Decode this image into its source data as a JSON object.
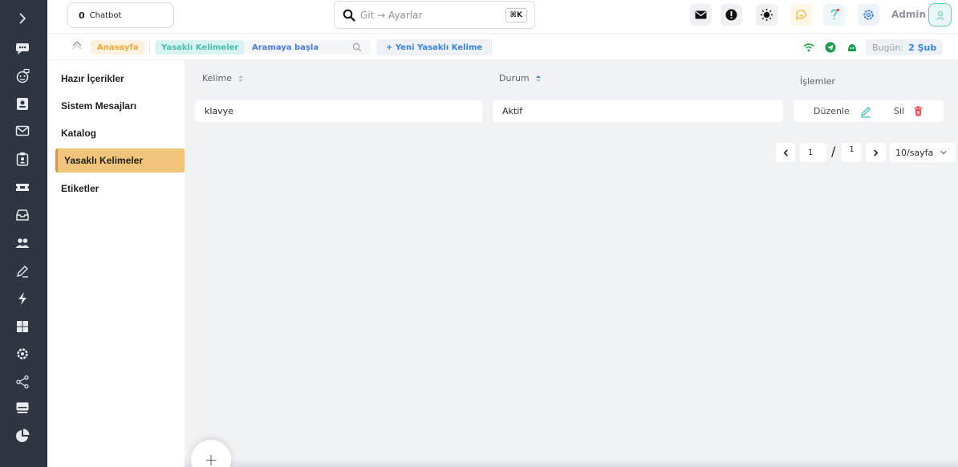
{
  "rail": {
    "icons": [
      "chevron-right-icon",
      "chat-bubbles-icon",
      "bot-face-icon",
      "contact-card-icon",
      "mail-icon",
      "clipboard-user-icon",
      "ticket-icon",
      "inbox-icon",
      "users-icon",
      "pen-icon",
      "bolt-icon",
      "grid-icon",
      "settings-gear-icon",
      "share-nodes-icon",
      "monitor-icon",
      "pie-chart-icon"
    ]
  },
  "topbar": {
    "chatbot_count": "0",
    "chatbot_label": "Chatbot",
    "search_placeholder": "Git → Ayarlar",
    "search_shortcut": "⌘K",
    "admin_label": "Admin"
  },
  "subbar": {
    "home": "Anasayfa",
    "current": "Yasaklı Kelimeler",
    "search_label": "Aramaya başla",
    "new_button": "+ Yeni Yasaklı Kelime",
    "today_label": "Bugün:",
    "today_value": "2 Şub"
  },
  "sidenav": {
    "items": [
      "Hazır İçerikler",
      "Sistem Mesajları",
      "Katalog",
      "Yasaklı Kelimeler",
      "Etiketler"
    ]
  },
  "table": {
    "headers": {
      "word": "Kelime",
      "status": "Durum",
      "actions": "İşlemler"
    },
    "rows": [
      {
        "word": "klavye",
        "status": "Aktif",
        "edit": "Düzenle",
        "delete": "Sil"
      }
    ]
  },
  "pager": {
    "current": "1",
    "slash": "/",
    "total": "1",
    "per_page": "10/sayfa"
  },
  "fab": {
    "label": "+"
  },
  "colors": {
    "rail_bg": "#2f3541",
    "active_item": "#f2c47b",
    "accent_blue": "#3b82e0",
    "accent_teal": "#47bdb3",
    "danger": "#e5484d"
  }
}
